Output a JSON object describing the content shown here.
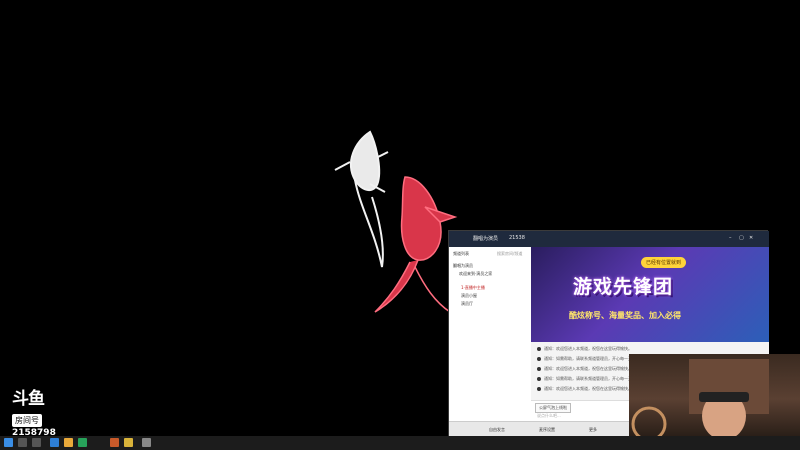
{
  "douyu": {
    "logo": "斗鱼",
    "room_label": "房间号",
    "room_number": "2158798"
  },
  "yy_window": {
    "title": "翻唱为演员",
    "room_id": "21538",
    "left_panel": {
      "header": "频道列表",
      "search_hint": "搜索房间/频道",
      "items": [
        "翻唱为演员",
        "欢迎来到·演员之家",
        "1·直播中主播",
        "演员小屋",
        "演员厅"
      ]
    },
    "banner": {
      "pill": "已经有位置就到",
      "title": "游戏先锋团",
      "subtitle": "酷炫称号、海量奖品、加入必得"
    },
    "chat_messages": [
      "通知：欢迎您进入本频道，祝您在这里玩得愉快。",
      "通知：如需帮助，请联系频道管理员，开心每一天！",
      "通知：欢迎您进入本频道，祝您在这里玩得愉快。",
      "通知：如需帮助，请联系频道管理员，开心每一天！",
      "通知：欢迎您进入本频道，祝您在这里玩得愉快。"
    ],
    "send_button": "公屏气泡上线啦",
    "input_placeholder": "说点什么吧...",
    "bottom_bar": {
      "mic": "自由发言",
      "record": "麦序设置",
      "tools": "更多"
    }
  },
  "colors": {
    "desktop": "#000000",
    "banner_start": "#2a1d5e",
    "banner_end": "#2c5fb8",
    "accent": "#ffd43a"
  }
}
